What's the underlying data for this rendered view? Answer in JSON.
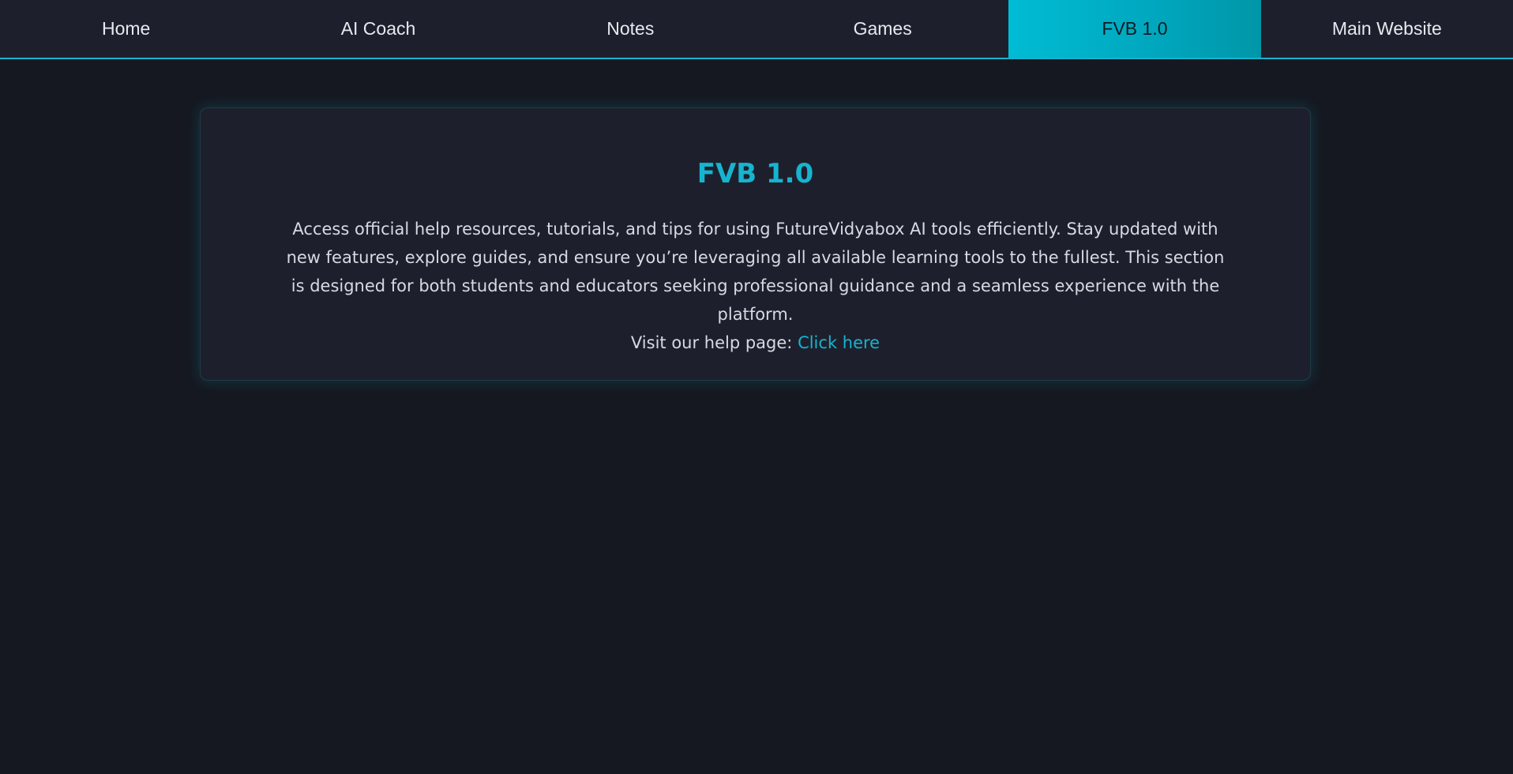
{
  "nav": {
    "items": [
      {
        "label": "Home"
      },
      {
        "label": "AI Coach"
      },
      {
        "label": "Notes"
      },
      {
        "label": "Games"
      },
      {
        "label": "FVB 1.0"
      },
      {
        "label": "Main Website"
      }
    ],
    "active_label": "FVB 1.0"
  },
  "card": {
    "title": "FVB 1.0",
    "description": "Access official help resources, tutorials, and tips for using FutureVidyabox AI tools efficiently. Stay updated with new features, explore guides, and ensure you’re leveraging all available learning tools to the fullest. This section is designed for both students and educators seeking professional guidance and a seamless experience with the platform.",
    "help_prefix": "Visit our help page:",
    "help_link_label": "Click here"
  },
  "colors": {
    "accent": "#16b4cf",
    "background": "#151820",
    "surface": "#1d202c",
    "text": "#d6dae2"
  }
}
